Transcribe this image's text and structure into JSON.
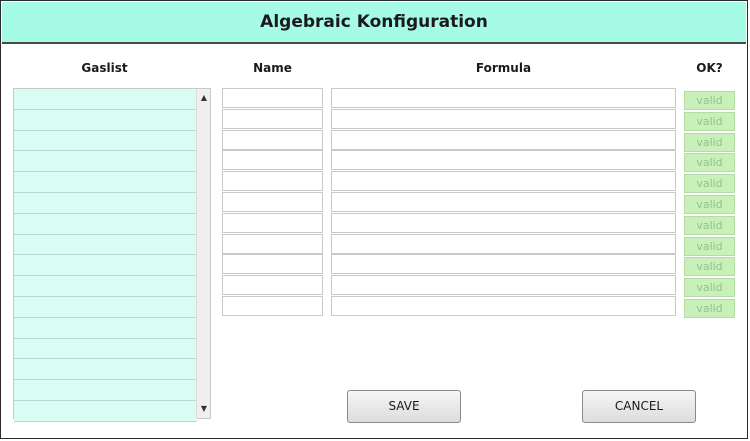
{
  "window": {
    "title": "Algebraic Konfiguration"
  },
  "headers": {
    "gaslist": "Gaslist",
    "name": "Name",
    "formula": "Formula",
    "ok": "OK?"
  },
  "gaslist": {
    "items": [
      "",
      "",
      "",
      "",
      "",
      "",
      "",
      "",
      "",
      "",
      "",
      "",
      "",
      "",
      "",
      ""
    ]
  },
  "rows": [
    {
      "name": "",
      "formula": "",
      "status": "valid"
    },
    {
      "name": "",
      "formula": "",
      "status": "valid"
    },
    {
      "name": "",
      "formula": "",
      "status": "valid"
    },
    {
      "name": "",
      "formula": "",
      "status": "valid"
    },
    {
      "name": "",
      "formula": "",
      "status": "valid"
    },
    {
      "name": "",
      "formula": "",
      "status": "valid"
    },
    {
      "name": "",
      "formula": "",
      "status": "valid"
    },
    {
      "name": "",
      "formula": "",
      "status": "valid"
    },
    {
      "name": "",
      "formula": "",
      "status": "valid"
    },
    {
      "name": "",
      "formula": "",
      "status": "valid"
    },
    {
      "name": "",
      "formula": "",
      "status": "valid"
    }
  ],
  "buttons": {
    "save": "SAVE",
    "cancel": "CANCEL"
  },
  "colors": {
    "title_bg": "#a6fbe6",
    "gaslist_bg": "#d9fdf3",
    "valid_bg": "#c8f0b8"
  }
}
